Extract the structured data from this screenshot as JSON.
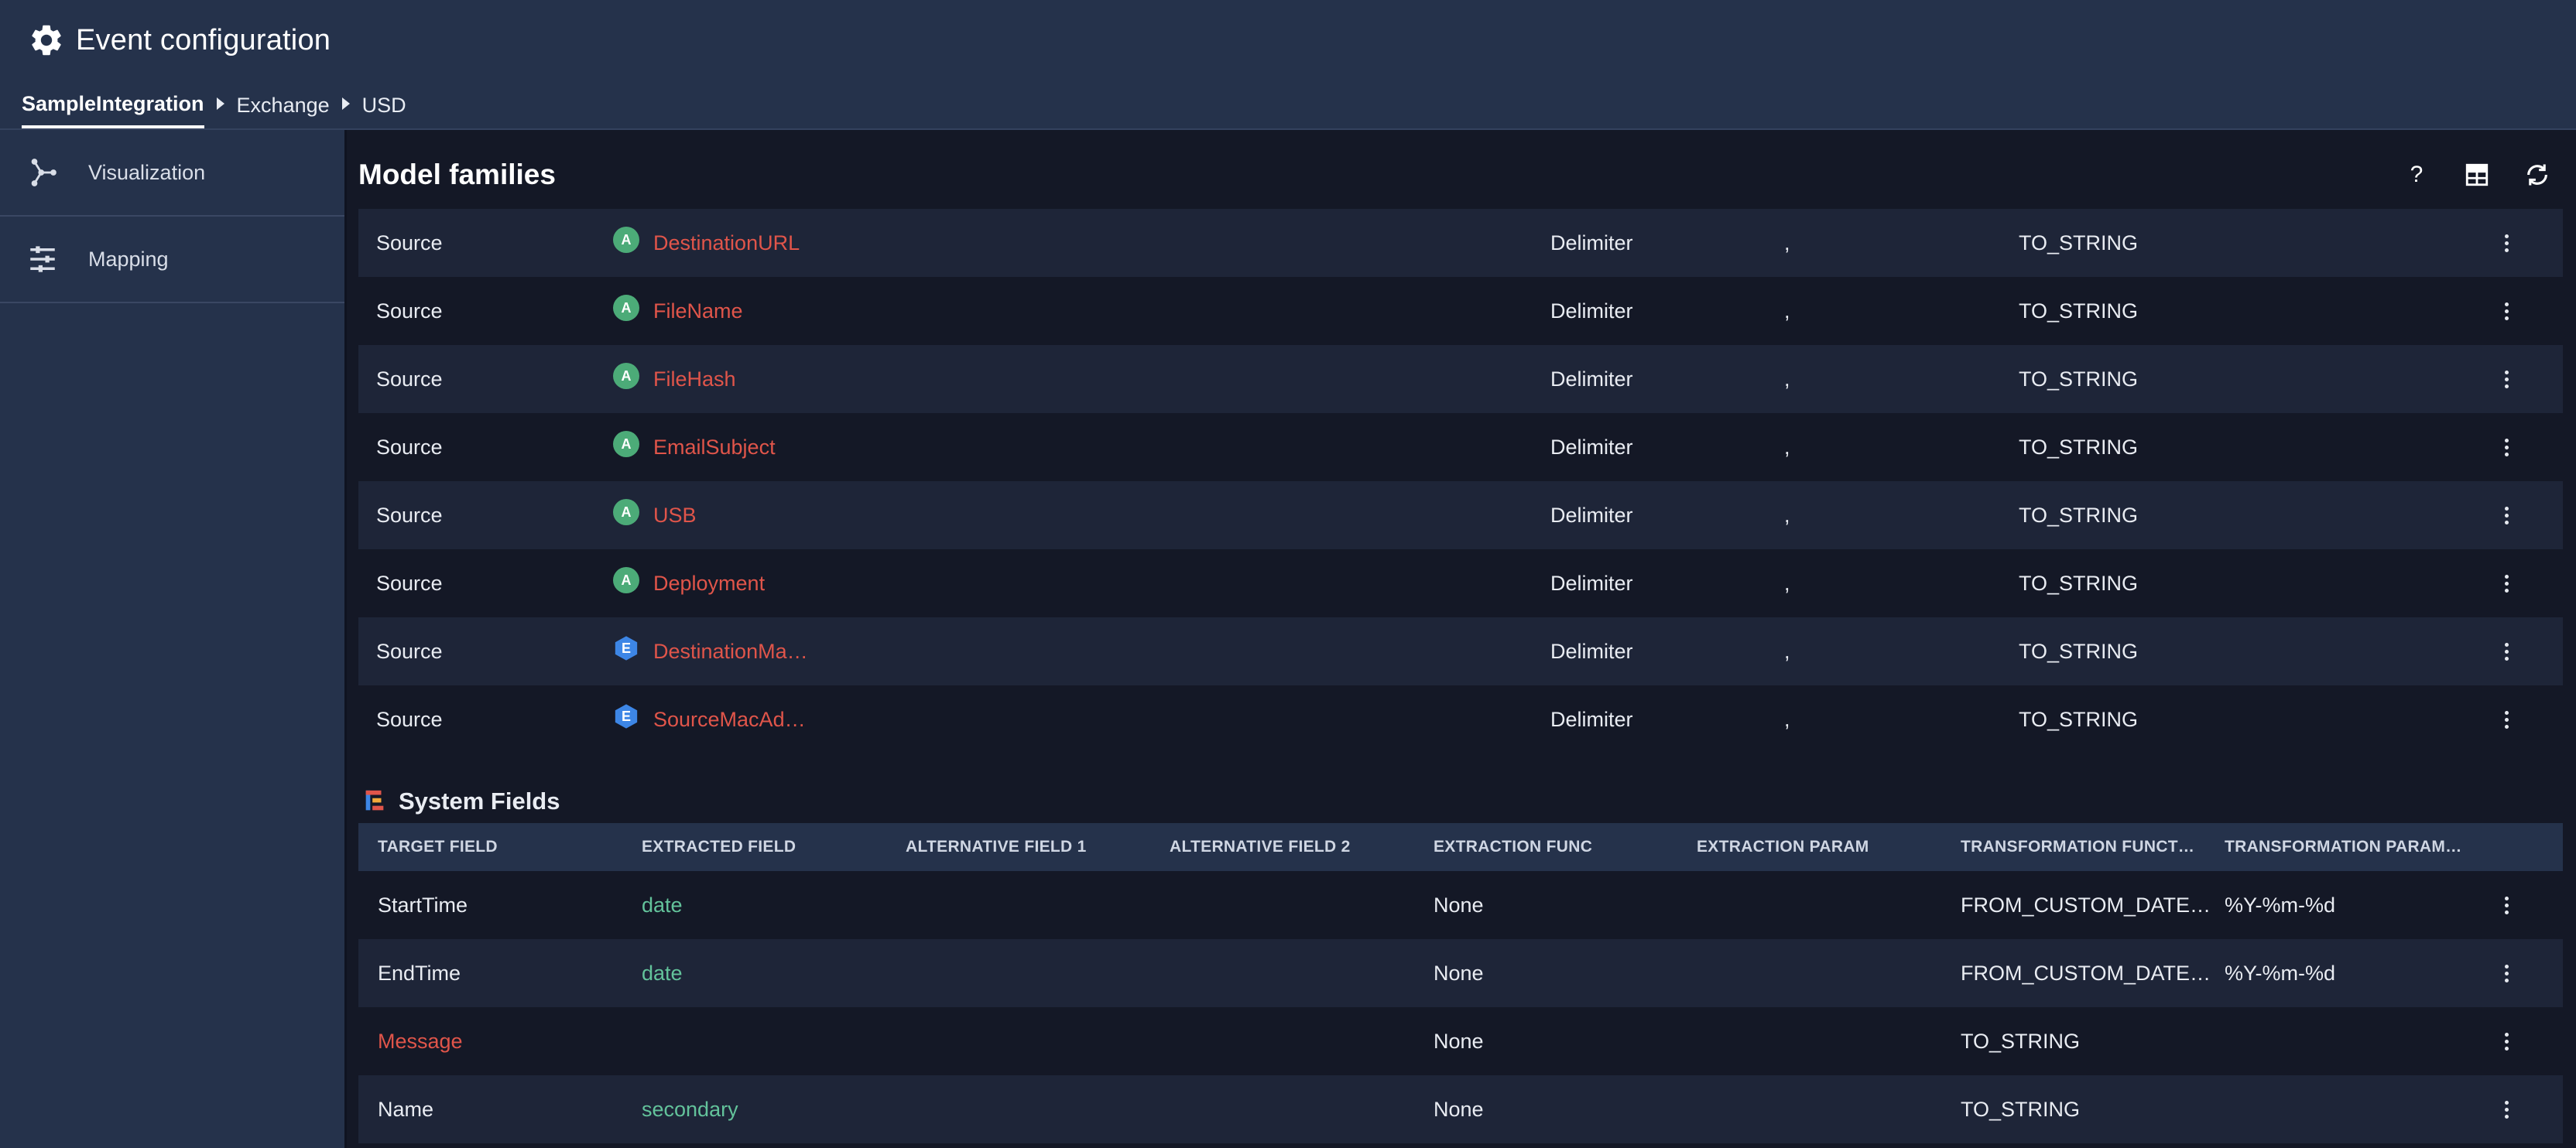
{
  "header": {
    "title": "Event configuration",
    "breadcrumb": [
      "SampleIntegration",
      "Exchange",
      "USD"
    ]
  },
  "sidebar": {
    "items": [
      {
        "label": "Visualization",
        "icon": "graph-nodes-icon"
      },
      {
        "label": "Mapping",
        "icon": "sliders-icon"
      }
    ]
  },
  "model_families": {
    "title": "Model families",
    "toolbar": {
      "help": "?",
      "table_icon": "table-settings-icon",
      "refresh_icon": "refresh-icon"
    },
    "rows": [
      {
        "source": "Source",
        "badge": "A",
        "badge_shape": "circle",
        "name": "DestinationURL",
        "type": "Delimiter",
        "param": ",",
        "func": "TO_STRING"
      },
      {
        "source": "Source",
        "badge": "A",
        "badge_shape": "circle",
        "name": "FileName",
        "type": "Delimiter",
        "param": ",",
        "func": "TO_STRING"
      },
      {
        "source": "Source",
        "badge": "A",
        "badge_shape": "circle",
        "name": "FileHash",
        "type": "Delimiter",
        "param": ",",
        "func": "TO_STRING"
      },
      {
        "source": "Source",
        "badge": "A",
        "badge_shape": "circle",
        "name": "EmailSubject",
        "type": "Delimiter",
        "param": ",",
        "func": "TO_STRING"
      },
      {
        "source": "Source",
        "badge": "A",
        "badge_shape": "circle",
        "name": "USB",
        "type": "Delimiter",
        "param": ",",
        "func": "TO_STRING"
      },
      {
        "source": "Source",
        "badge": "A",
        "badge_shape": "circle",
        "name": "Deployment",
        "type": "Delimiter",
        "param": ",",
        "func": "TO_STRING"
      },
      {
        "source": "Source",
        "badge": "E",
        "badge_shape": "hexagon",
        "name": "DestinationMa…",
        "type": "Delimiter",
        "param": ",",
        "func": "TO_STRING"
      },
      {
        "source": "Source",
        "badge": "E",
        "badge_shape": "hexagon",
        "name": "SourceMacAd…",
        "type": "Delimiter",
        "param": ",",
        "func": "TO_STRING"
      }
    ]
  },
  "system_fields": {
    "title": "System Fields",
    "columns": [
      "TARGET FIELD",
      "EXTRACTED FIELD",
      "ALTERNATIVE FIELD 1",
      "ALTERNATIVE FIELD 2",
      "EXTRACTION FUNC",
      "EXTRACTION PARAM",
      "TRANSFORMATION FUNCT…",
      "TRANSFORMATION PARAM…"
    ],
    "rows": [
      {
        "target": "StartTime",
        "target_highlight": false,
        "extracted": "date",
        "alt1": "",
        "alt2": "",
        "extraction_func": "None",
        "extraction_param": "",
        "transformation_func": "FROM_CUSTOM_DATE…",
        "transformation_param": "%Y-%m-%d"
      },
      {
        "target": "EndTime",
        "target_highlight": false,
        "extracted": "date",
        "alt1": "",
        "alt2": "",
        "extraction_func": "None",
        "extraction_param": "",
        "transformation_func": "FROM_CUSTOM_DATE…",
        "transformation_param": "%Y-%m-%d"
      },
      {
        "target": "Message",
        "target_highlight": true,
        "extracted": "",
        "alt1": "",
        "alt2": "",
        "extraction_func": "None",
        "extraction_param": "",
        "transformation_func": "TO_STRING",
        "transformation_param": ""
      },
      {
        "target": "Name",
        "target_highlight": false,
        "extracted": "secondary",
        "alt1": "",
        "alt2": "",
        "extraction_func": "None",
        "extraction_param": "",
        "transformation_func": "TO_STRING",
        "transformation_param": ""
      }
    ]
  },
  "colors": {
    "header_bg": "#25324b",
    "main_bg": "#141826",
    "alt_row_bg": "#1e2538",
    "accent_red": "#e0554a",
    "accent_teal": "#63c39b",
    "badge_green": "#4cab78",
    "badge_blue": "#3d86e6"
  }
}
